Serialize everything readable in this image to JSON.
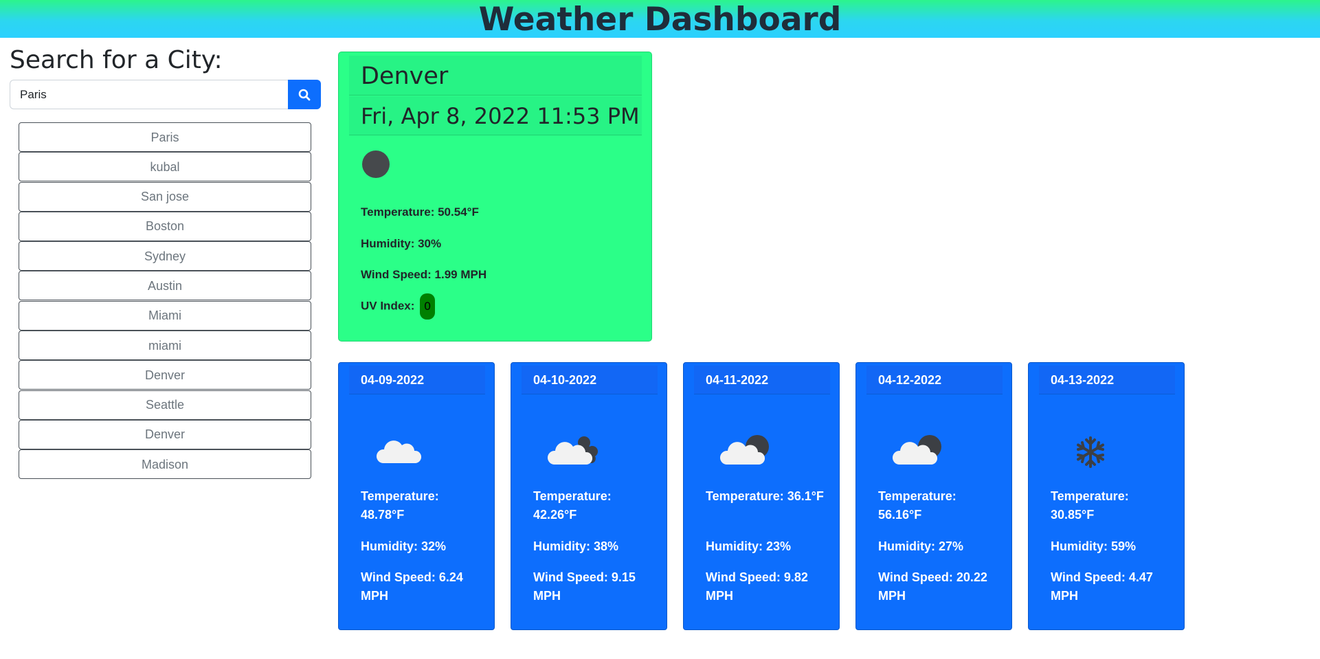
{
  "header": {
    "title": "Weather Dashboard"
  },
  "search": {
    "title": "Search for a City:",
    "value": "Paris"
  },
  "history": [
    "Paris",
    "kubal",
    "San jose",
    "Boston",
    "Sydney",
    "Austin",
    "Miami",
    "miami",
    "Denver",
    "Seattle",
    "Denver",
    "Madison"
  ],
  "current": {
    "city": "Denver",
    "date": "Fri, Apr 8, 2022 11:53 PM",
    "icon": "moon-icon",
    "temperature": "Temperature: 50.54°F",
    "humidity": "Humidity: 30%",
    "wind": "Wind Speed: 1.99 MPH",
    "uv_label": "UV Index:",
    "uv_value": "0"
  },
  "forecast": [
    {
      "date": "04-09-2022",
      "icon": "cloud-icon",
      "temp": "Temperature: 48.78°F",
      "humidity": "Humidity: 32%",
      "wind": "Wind Speed: 6.24 MPH"
    },
    {
      "date": "04-10-2022",
      "icon": "cloudy-night-icon",
      "temp": "Temperature: 42.26°F",
      "humidity": "Humidity: 38%",
      "wind": "Wind Speed: 9.15 MPH"
    },
    {
      "date": "04-11-2022",
      "icon": "partly-cloudy-night-icon",
      "temp": "Temperature: 36.1°F",
      "humidity": "Humidity: 23%",
      "wind": "Wind Speed: 9.82 MPH"
    },
    {
      "date": "04-12-2022",
      "icon": "partly-cloudy-night-icon",
      "temp": "Temperature: 56.16°F",
      "humidity": "Humidity: 27%",
      "wind": "Wind Speed: 20.22 MPH"
    },
    {
      "date": "04-13-2022",
      "icon": "snow-icon",
      "temp": "Temperature: 30.85°F",
      "humidity": "Humidity: 59%",
      "wind": "Wind Speed: 4.47 MPH"
    }
  ],
  "colors": {
    "primary": "#0d6efd",
    "current_card": "#2bff88",
    "uv_good": "#008000"
  }
}
